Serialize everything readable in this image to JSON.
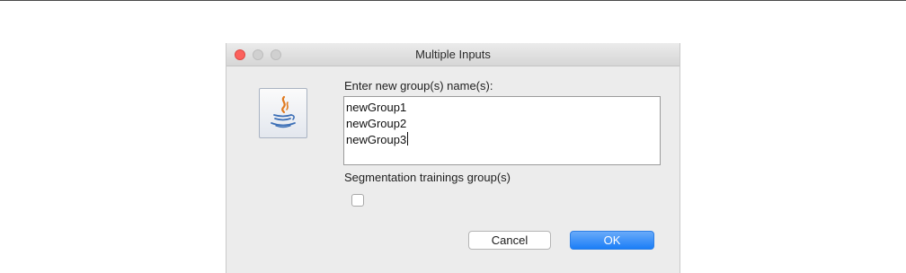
{
  "window": {
    "title": "Multiple Inputs"
  },
  "dialog": {
    "icon": "java-icon",
    "prompt": "Enter new group(s) name(s):",
    "names": [
      "newGroup1",
      "newGroup2",
      "newGroup3"
    ],
    "segmentation_label": "Segmentation trainings group(s)",
    "segmentation_checked": false
  },
  "buttons": {
    "cancel_label": "Cancel",
    "ok_label": "OK"
  },
  "colors": {
    "close_light": "#fc615d",
    "ok_button": "#1b7ef7",
    "dialog_background": "#ececec"
  }
}
